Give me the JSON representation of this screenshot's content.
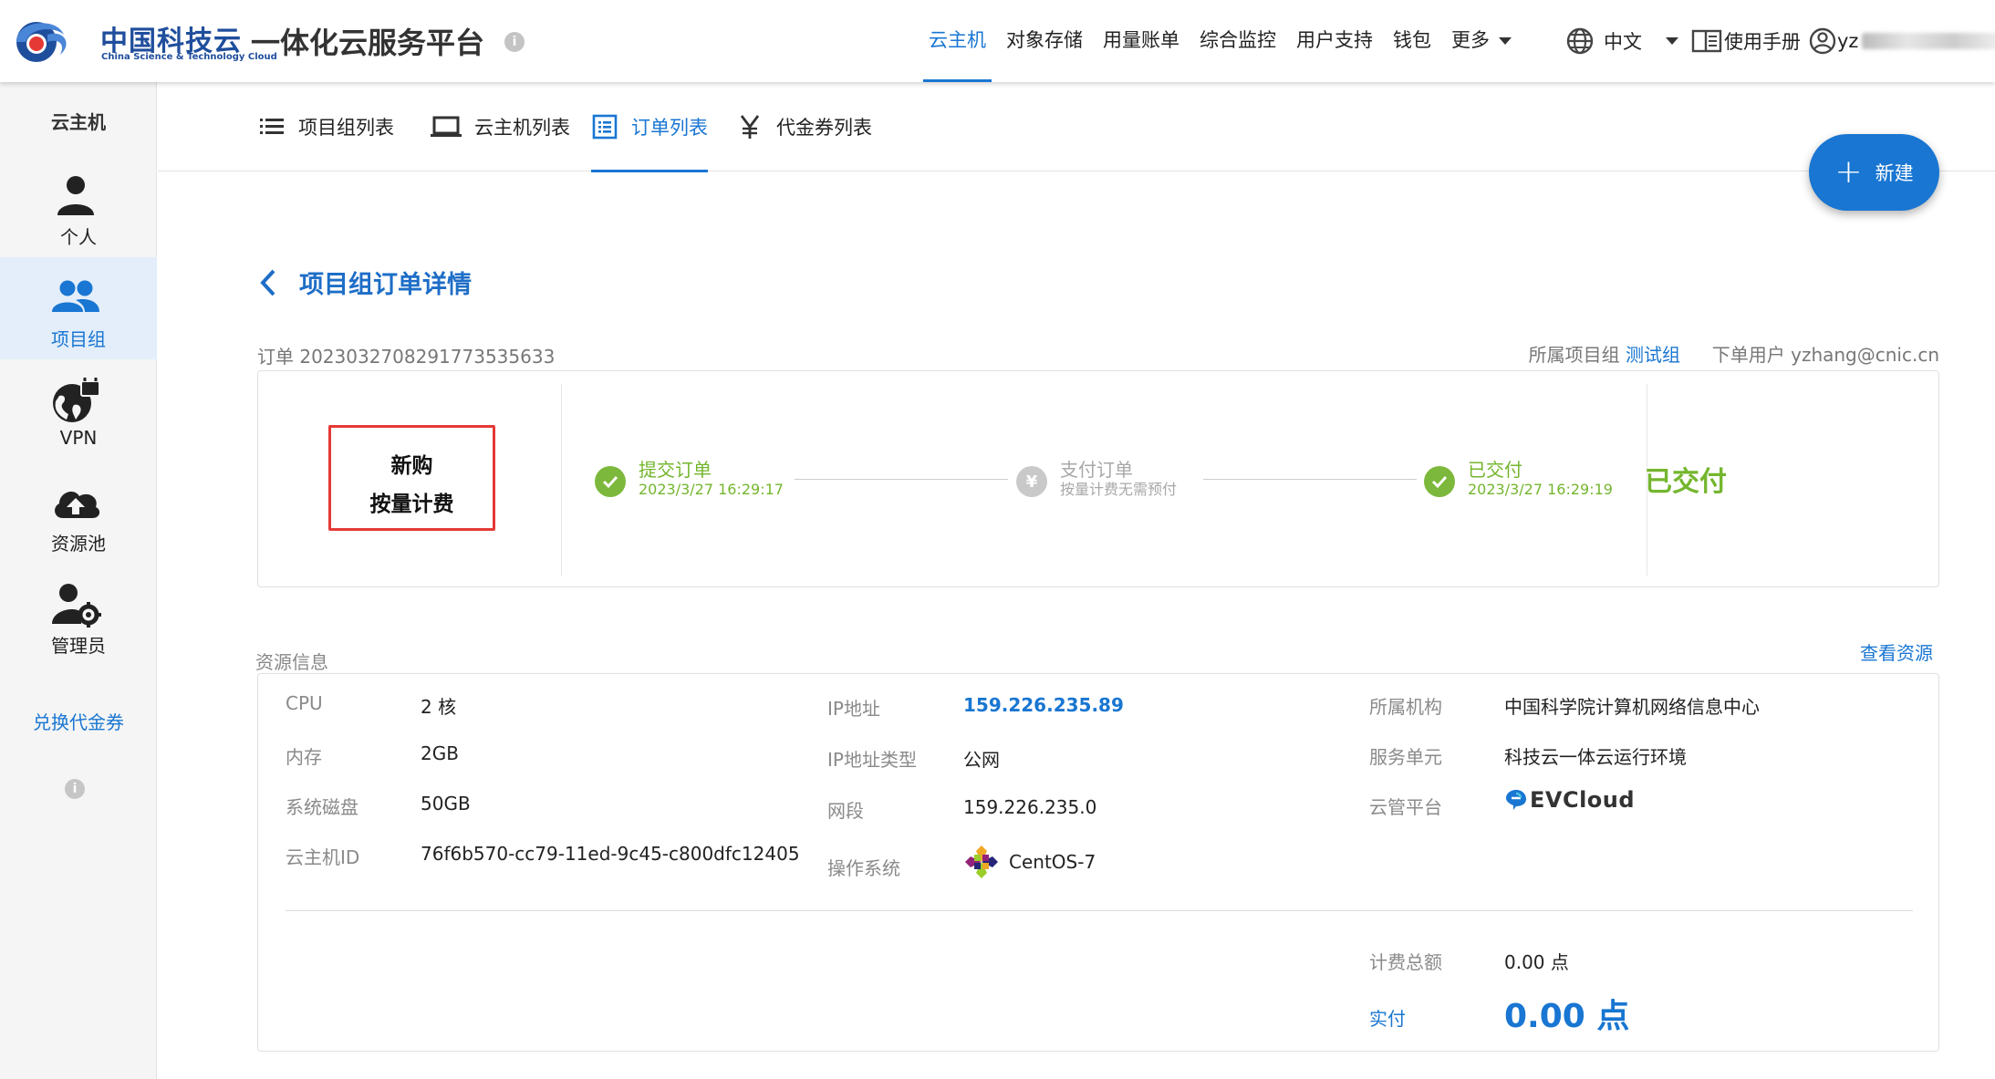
{
  "header": {
    "brand_cn": "中国科技云",
    "brand_en": "China Science & Technology Cloud",
    "platform_title": "一体化云服务平台",
    "nav": [
      {
        "label": "云主机",
        "active": true
      },
      {
        "label": "对象存储"
      },
      {
        "label": "用量账单"
      },
      {
        "label": "综合监控"
      },
      {
        "label": "用户支持"
      },
      {
        "label": "钱包"
      },
      {
        "label": "更多"
      }
    ],
    "language": "中文",
    "manual": "使用手册",
    "user": "yz"
  },
  "sidebar": {
    "title": "云主机",
    "items": [
      {
        "label": "个人",
        "icon": "person-icon"
      },
      {
        "label": "项目组",
        "icon": "group-icon",
        "active": true
      },
      {
        "label": "VPN",
        "icon": "vpn-icon"
      },
      {
        "label": "资源池",
        "icon": "cloud-upload-icon"
      },
      {
        "label": "管理员",
        "icon": "admin-icon"
      }
    ],
    "voucher_link": "兑换代金券"
  },
  "tabs": [
    {
      "label": "项目组列表",
      "icon": "list-icon"
    },
    {
      "label": "云主机列表",
      "icon": "laptop-icon"
    },
    {
      "label": "订单列表",
      "icon": "order-list-icon",
      "active": true
    },
    {
      "label": "代金券列表",
      "icon": "yen-icon"
    }
  ],
  "fab_label": "新建",
  "detail": {
    "title": "项目组订单详情",
    "order_label": "订单",
    "order_id": "2023032708291773535633",
    "project_label": "所属项目组",
    "project_name": "测试组",
    "orderer_label": "下单用户",
    "orderer": "yzhang@cnic.cn",
    "order_type": "新购",
    "billing_type": "按量计费",
    "steps": [
      {
        "title": "提交订单",
        "sub": "2023/3/27 16:29:17",
        "state": "done"
      },
      {
        "title": "支付订单",
        "sub": "按量计费无需预付",
        "state": "skipped"
      },
      {
        "title": "已交付",
        "sub": "2023/3/27 16:29:19",
        "state": "done"
      }
    ],
    "status": "已交付"
  },
  "resource": {
    "title": "资源信息",
    "view_link": "查看资源",
    "col1": [
      {
        "label": "CPU",
        "value": "2 核"
      },
      {
        "label": "内存",
        "value": "2GB"
      },
      {
        "label": "系统磁盘",
        "value": "50GB"
      },
      {
        "label": "云主机ID",
        "value": "76f6b570-cc79-11ed-9c45-c800dfc12405"
      }
    ],
    "col2": [
      {
        "label": "IP地址",
        "value": "159.226.235.89"
      },
      {
        "label": "IP地址类型",
        "value": "公网"
      },
      {
        "label": "网段",
        "value": "159.226.235.0"
      },
      {
        "label": "操作系统",
        "value": "CentOS-7"
      }
    ],
    "col3": [
      {
        "label": "所属机构",
        "value": "中国科学院计算机网络信息中心"
      },
      {
        "label": "服务单元",
        "value": "科技云一体云运行环境"
      },
      {
        "label": "云管平台",
        "value": "EVCloud"
      }
    ],
    "total_label": "计费总额",
    "total_value": "0.00 点",
    "paid_label": "实付",
    "paid_value": "0.00 点"
  }
}
